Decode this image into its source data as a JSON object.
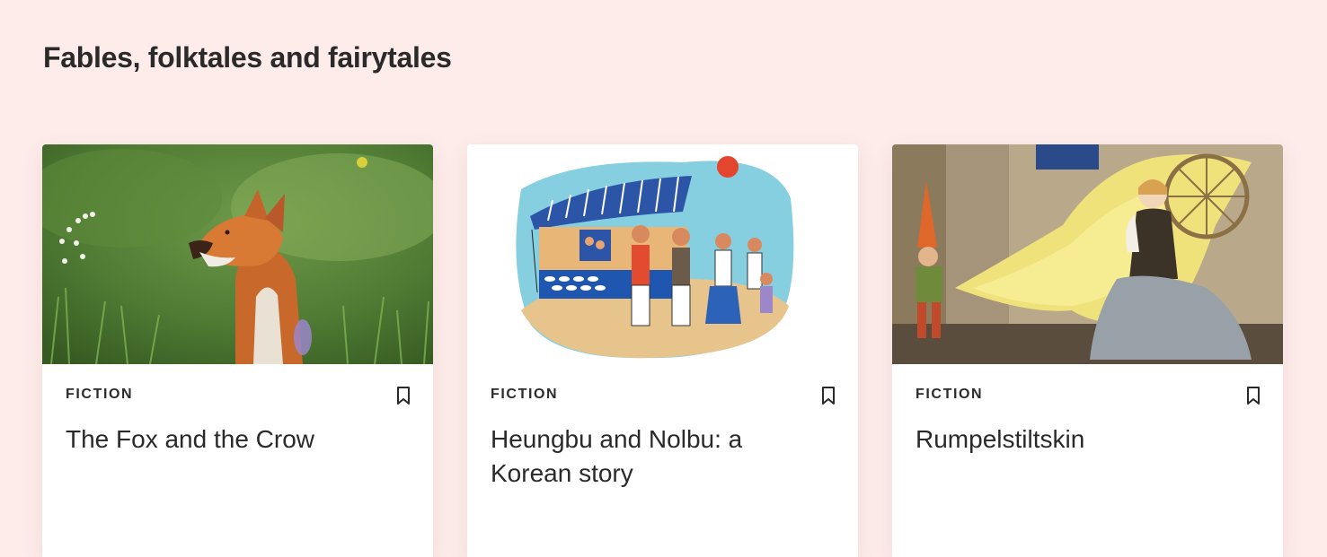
{
  "section": {
    "title": "Fables, folktales and fairytales"
  },
  "cards": [
    {
      "category": "FICTION",
      "title": "The Fox and the Crow",
      "image_icon": "fox-photo",
      "bookmark_icon": "bookmark-icon"
    },
    {
      "category": "FICTION",
      "title": "Heungbu and Nolbu: a Korean story",
      "image_icon": "korean-family-illustration",
      "bookmark_icon": "bookmark-icon"
    },
    {
      "category": "FICTION",
      "title": "Rumpelstiltskin",
      "image_icon": "rumpelstiltskin-illustration",
      "bookmark_icon": "bookmark-icon"
    }
  ],
  "colors": {
    "page_background": "#fdecea",
    "card_background": "#ffffff",
    "text": "#2a2a2a"
  }
}
